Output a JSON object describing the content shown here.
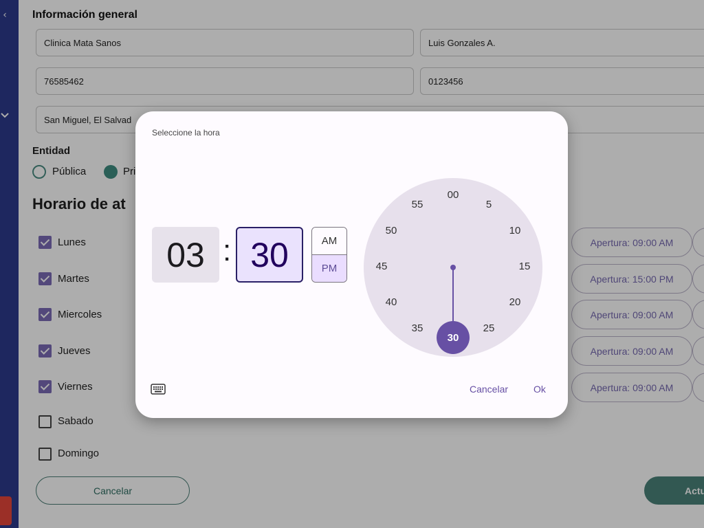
{
  "sidebar": {
    "back_icon": "chevron-left-icon",
    "expand_icon": "chevron-down-icon"
  },
  "form": {
    "section_title": "Información general",
    "fields": {
      "clinic_name": "Clinica Mata Sanos",
      "contact_name": "Luis Gonzales A.",
      "phone": "76585462",
      "registration": "0123456",
      "address": "San Miguel, El Salvad"
    },
    "entidad": {
      "label": "Entidad",
      "options": [
        "Pública",
        "Pri"
      ],
      "selected": "Pri"
    },
    "horario_title": "Horario de at"
  },
  "days": [
    {
      "label": "Lunes",
      "checked": true,
      "opening": "Apertura: 09:00 AM"
    },
    {
      "label": "Martes",
      "checked": true,
      "opening": "Apertura: 15:00 PM"
    },
    {
      "label": "Miercoles",
      "checked": true,
      "opening": "Apertura: 09:00 AM"
    },
    {
      "label": "Jueves",
      "checked": true,
      "opening": "Apertura: 09:00 AM"
    },
    {
      "label": "Viernes",
      "checked": true,
      "opening": "Apertura: 09:00 AM"
    },
    {
      "label": "Sabado",
      "checked": false
    },
    {
      "label": "Domingo",
      "checked": false
    }
  ],
  "buttons": {
    "cancel": "Cancelar",
    "update": "Actu"
  },
  "time_picker": {
    "title": "Seleccione la hora",
    "hour": "03",
    "separator": ":",
    "minute": "30",
    "am": "AM",
    "pm": "PM",
    "period_selected": "PM",
    "clock_numbers": [
      "00",
      "5",
      "10",
      "15",
      "20",
      "25",
      "30",
      "35",
      "40",
      "45",
      "50",
      "55"
    ],
    "selected_minute": "30",
    "keyboard_icon": "keyboard-icon",
    "cancel": "Cancelar",
    "ok": "Ok"
  },
  "colors": {
    "sidebar": "#2d3a8c",
    "primary_purple": "#6750a4",
    "teal": "#4a8279",
    "checkbox": "#7b6bb5"
  }
}
